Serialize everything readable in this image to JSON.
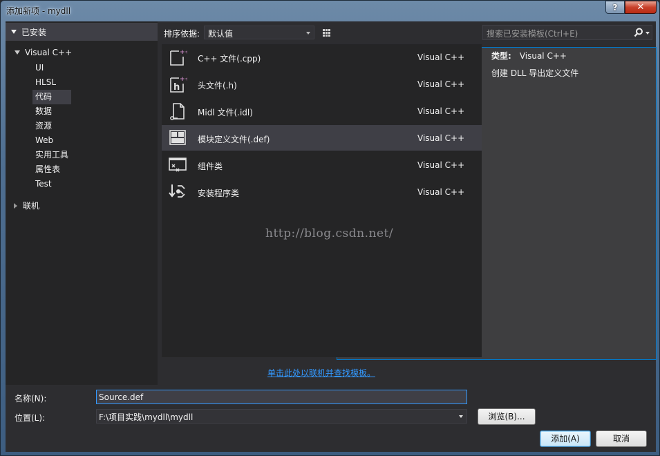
{
  "window": {
    "title": "添加新项 - mydll",
    "help": "?",
    "close": "✕"
  },
  "sidebar": {
    "installed": "已安装",
    "root": "Visual C++",
    "items": [
      {
        "label": "UI"
      },
      {
        "label": "HLSL"
      },
      {
        "label": "代码",
        "selected": true
      },
      {
        "label": "数据"
      },
      {
        "label": "资源"
      },
      {
        "label": "Web"
      },
      {
        "label": "实用工具"
      },
      {
        "label": "属性表"
      },
      {
        "label": "Test"
      }
    ],
    "online": "联机"
  },
  "toolbar": {
    "sort_label": "排序依据:",
    "sort_value": "默认值"
  },
  "search": {
    "placeholder": "搜索已安装模板(Ctrl+E)"
  },
  "templates": [
    {
      "name": "C++ 文件(.cpp)",
      "lang": "Visual C++",
      "icon": "cpp-file-icon"
    },
    {
      "name": "头文件(.h)",
      "lang": "Visual C++",
      "icon": "header-file-icon"
    },
    {
      "name": "Midl 文件(.idl)",
      "lang": "Visual C++",
      "icon": "idl-file-icon"
    },
    {
      "name": "模块定义文件(.def)",
      "lang": "Visual C++",
      "icon": "def-file-icon",
      "selected": true
    },
    {
      "name": "组件类",
      "lang": "Visual C++",
      "icon": "component-class-icon"
    },
    {
      "name": "安装程序类",
      "lang": "Visual C++",
      "icon": "installer-class-icon"
    }
  ],
  "watermark": "http://blog.csdn.net/",
  "info": {
    "type_label": "类型:",
    "type_value": "Visual C++",
    "description": "创建 DLL 导出定义文件"
  },
  "online_link": "单击此处以联机并查找模板。",
  "form": {
    "name_label": "名称(N):",
    "name_value": "Source.def",
    "location_label": "位置(L):",
    "location_value": "F:\\项目实践\\mydll\\mydll",
    "browse": "浏览(B)...",
    "add": "添加(A)",
    "cancel": "取消"
  }
}
